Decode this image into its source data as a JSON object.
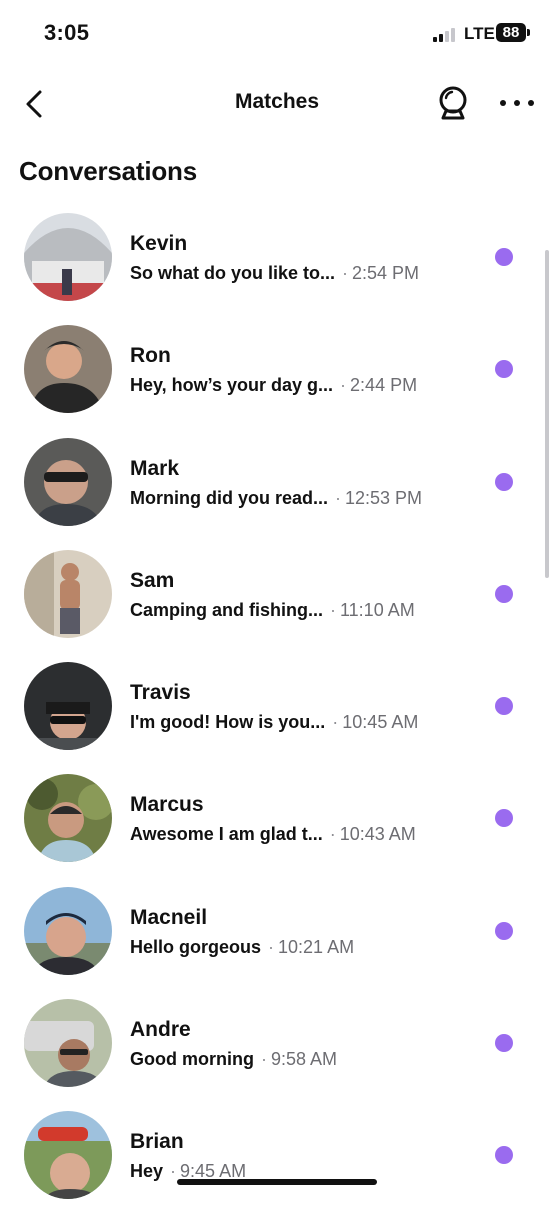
{
  "status_bar": {
    "time": "3:05",
    "network": "LTE",
    "battery": "88"
  },
  "header": {
    "title": "Matches"
  },
  "section_title": "Conversations",
  "conversations": [
    {
      "name": "Kevin",
      "preview": "So what do you like to...",
      "time": "2:54 PM",
      "unread": true
    },
    {
      "name": "Ron",
      "preview": "Hey, how’s your day g...",
      "time": "2:44 PM",
      "unread": true
    },
    {
      "name": "Mark",
      "preview": "Morning did you read...",
      "time": "12:53 PM",
      "unread": true
    },
    {
      "name": "Sam",
      "preview": "Camping and fishing...",
      "time": "11:10 AM",
      "unread": true
    },
    {
      "name": "Travis",
      "preview": "I'm good! How is you...",
      "time": "10:45 AM",
      "unread": true
    },
    {
      "name": "Marcus",
      "preview": "Awesome I am glad t...",
      "time": "10:43 AM",
      "unread": true
    },
    {
      "name": "Macneil",
      "preview": "Hello gorgeous",
      "time": "10:21 AM",
      "unread": true
    },
    {
      "name": "Andre",
      "preview": "Good morning",
      "time": "9:58 AM",
      "unread": true
    },
    {
      "name": "Brian",
      "preview": "Hey",
      "time": "9:45 AM",
      "unread": true
    }
  ],
  "colors": {
    "unread_dot": "#9a6bef",
    "timestamp": "#6d6d72"
  }
}
